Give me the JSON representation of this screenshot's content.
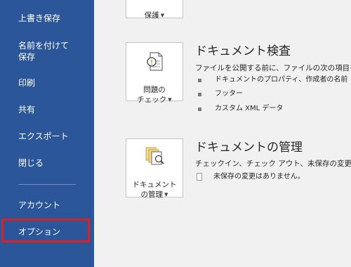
{
  "sidebar": {
    "items": [
      {
        "label": "上書き保存"
      },
      {
        "label": "名前を付けて\n保存"
      },
      {
        "label": "印刷"
      },
      {
        "label": "共有"
      },
      {
        "label": "エクスポート"
      },
      {
        "label": "閉じる"
      },
      {
        "label": "アカウント"
      },
      {
        "label": "オプション"
      }
    ],
    "highlight_color": "#e01e1e",
    "background_color": "#2b579a"
  },
  "protect": {
    "button_label": "保護"
  },
  "inspect": {
    "button_label": "問題の\nチェック",
    "title": "ドキュメント検査",
    "description": "ファイルを公開する前に、ファイルの次の項目を確",
    "items": [
      {
        "label": "ドキュメントのプロパティ、作成者の名前"
      },
      {
        "label": "フッター"
      },
      {
        "label": "カスタム XML データ"
      }
    ]
  },
  "manage": {
    "button_label": "ドキュメント\nの管理",
    "title": "ドキュメントの管理",
    "description": "チェックイン、チェック アウト、未保存の変更の回",
    "status": "未保存の変更はありません。"
  }
}
